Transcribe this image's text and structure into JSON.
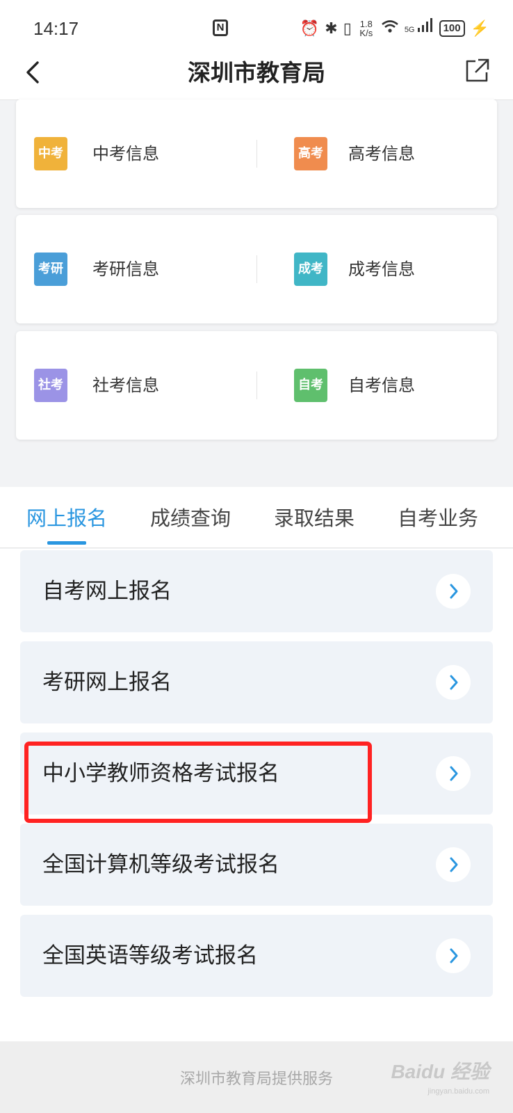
{
  "status_bar": {
    "time": "14:17",
    "nfc": "N",
    "speed_top": "1.8",
    "speed_bottom": "K/s",
    "network": "5G",
    "battery": "100"
  },
  "header": {
    "title": "深圳市教育局",
    "back_icon": "chevron-left-icon",
    "share_icon": "share-icon"
  },
  "info_cards": [
    {
      "left": {
        "badge": "中考",
        "label": "中考信息",
        "color": "#f0b23a"
      },
      "right": {
        "badge": "高考",
        "label": "高考信息",
        "color": "#f08c4e"
      }
    },
    {
      "left": {
        "badge": "考研",
        "label": "考研信息",
        "color": "#4a9ed8"
      },
      "right": {
        "badge": "成考",
        "label": "成考信息",
        "color": "#40b6c6"
      }
    },
    {
      "left": {
        "badge": "社考",
        "label": "社考信息",
        "color": "#9b93e6"
      },
      "right": {
        "badge": "自考",
        "label": "自考信息",
        "color": "#5fbf6d"
      }
    }
  ],
  "tabs": [
    {
      "label": "网上报名",
      "active": true
    },
    {
      "label": "成绩查询",
      "active": false
    },
    {
      "label": "录取结果",
      "active": false
    },
    {
      "label": "自考业务",
      "active": false
    }
  ],
  "list_items": [
    {
      "label": "自考网上报名"
    },
    {
      "label": "考研网上报名"
    },
    {
      "label": "中小学教师资格考试报名",
      "highlighted": true
    },
    {
      "label": "全国计算机等级考试报名"
    },
    {
      "label": "全国英语等级考试报名"
    }
  ],
  "footer": {
    "text": "深圳市教育局提供服务",
    "watermark": "Baidu 经验",
    "watermark_sub": "jingyan.baidu.com"
  },
  "colors": {
    "accent": "#2996e0",
    "highlight": "#ff2222",
    "item_bg": "#eff3f8"
  }
}
